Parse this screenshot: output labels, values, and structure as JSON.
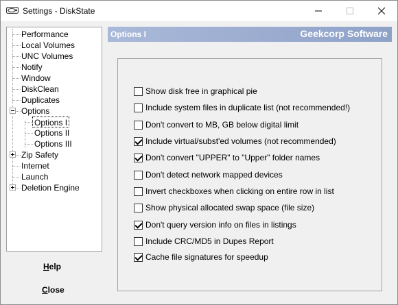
{
  "window": {
    "title": "Settings - DiskState"
  },
  "tree": {
    "items": [
      {
        "label": "Performance"
      },
      {
        "label": "Local Volumes"
      },
      {
        "label": "UNC Volumes"
      },
      {
        "label": "Notify"
      },
      {
        "label": "Window"
      },
      {
        "label": "DiskClean"
      },
      {
        "label": "Duplicates"
      },
      {
        "label": "Options",
        "expanded": true
      },
      {
        "label": "Options I",
        "selected": true
      },
      {
        "label": "Options II"
      },
      {
        "label": "Options III"
      },
      {
        "label": "Zip Safety",
        "expanded": false
      },
      {
        "label": "Internet"
      },
      {
        "label": "Launch"
      },
      {
        "label": "Deletion Engine",
        "expanded": false
      }
    ]
  },
  "buttons": {
    "help": {
      "accel": "H",
      "rest": "elp"
    },
    "close": {
      "accel": "C",
      "rest": "lose"
    }
  },
  "header": {
    "section": "Options I",
    "brand": "Geekcorp Software"
  },
  "options": [
    {
      "label": "Show disk free in graphical pie",
      "checked": false
    },
    {
      "label": "Include system files in duplicate list (not recommended!)",
      "checked": false
    },
    {
      "label": "Don't convert to MB, GB below digital limit",
      "checked": false
    },
    {
      "label": "Include virtual/subst'ed volumes (not recommended)",
      "checked": true
    },
    {
      "label": "Don't convert \"UPPER\" to \"Upper\" folder names",
      "checked": true
    },
    {
      "label": "Don't detect network mapped devices",
      "checked": false
    },
    {
      "label": "Invert checkboxes when clicking on entire row in list",
      "checked": false
    },
    {
      "label": "Show physical allocated swap space (file size)",
      "checked": false
    },
    {
      "label": "Don't query version info on files in listings",
      "checked": true
    },
    {
      "label": "Include CRC/MD5 in Dupes Report",
      "checked": false
    },
    {
      "label": "Cache file signatures for speedup",
      "checked": true
    }
  ]
}
